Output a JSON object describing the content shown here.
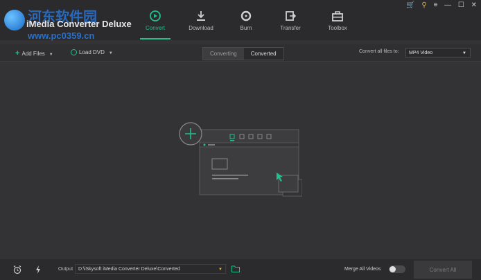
{
  "app": {
    "title": "iMedia Converter Deluxe",
    "watermark_text": "河东软件园",
    "watermark_url": "www.pc0359.cn"
  },
  "nav": {
    "items": [
      {
        "label": "Convert",
        "icon": "convert-icon",
        "active": true
      },
      {
        "label": "Download",
        "icon": "download-icon",
        "active": false
      },
      {
        "label": "Burn",
        "icon": "burn-icon",
        "active": false
      },
      {
        "label": "Transfer",
        "icon": "transfer-icon",
        "active": false
      },
      {
        "label": "Toolbox",
        "icon": "toolbox-icon",
        "active": false
      }
    ],
    "accent": "#22c08a"
  },
  "window_controls": {
    "cart": "🛒",
    "key": "⚲",
    "menu": "≡",
    "minimize": "—",
    "maximize": "☐",
    "close": "✕"
  },
  "toolbar": {
    "add_files": "Add Files",
    "load_dvd": "Load DVD",
    "tab_converting": "Converting",
    "tab_converted": "Converted",
    "convert_all_to_label": "Convert all files to:",
    "format_value": "MP4 Video"
  },
  "bottombar": {
    "output_label": "Output",
    "output_path": "D:\\iSkysoft iMedia Converter Deluxe\\Converted",
    "merge_label": "Merge All Videos",
    "merge_on": false,
    "convert_all": "Convert All"
  },
  "colors": {
    "background": "#333234",
    "topbar": "#2b2a2c",
    "accent": "#22c08a"
  }
}
